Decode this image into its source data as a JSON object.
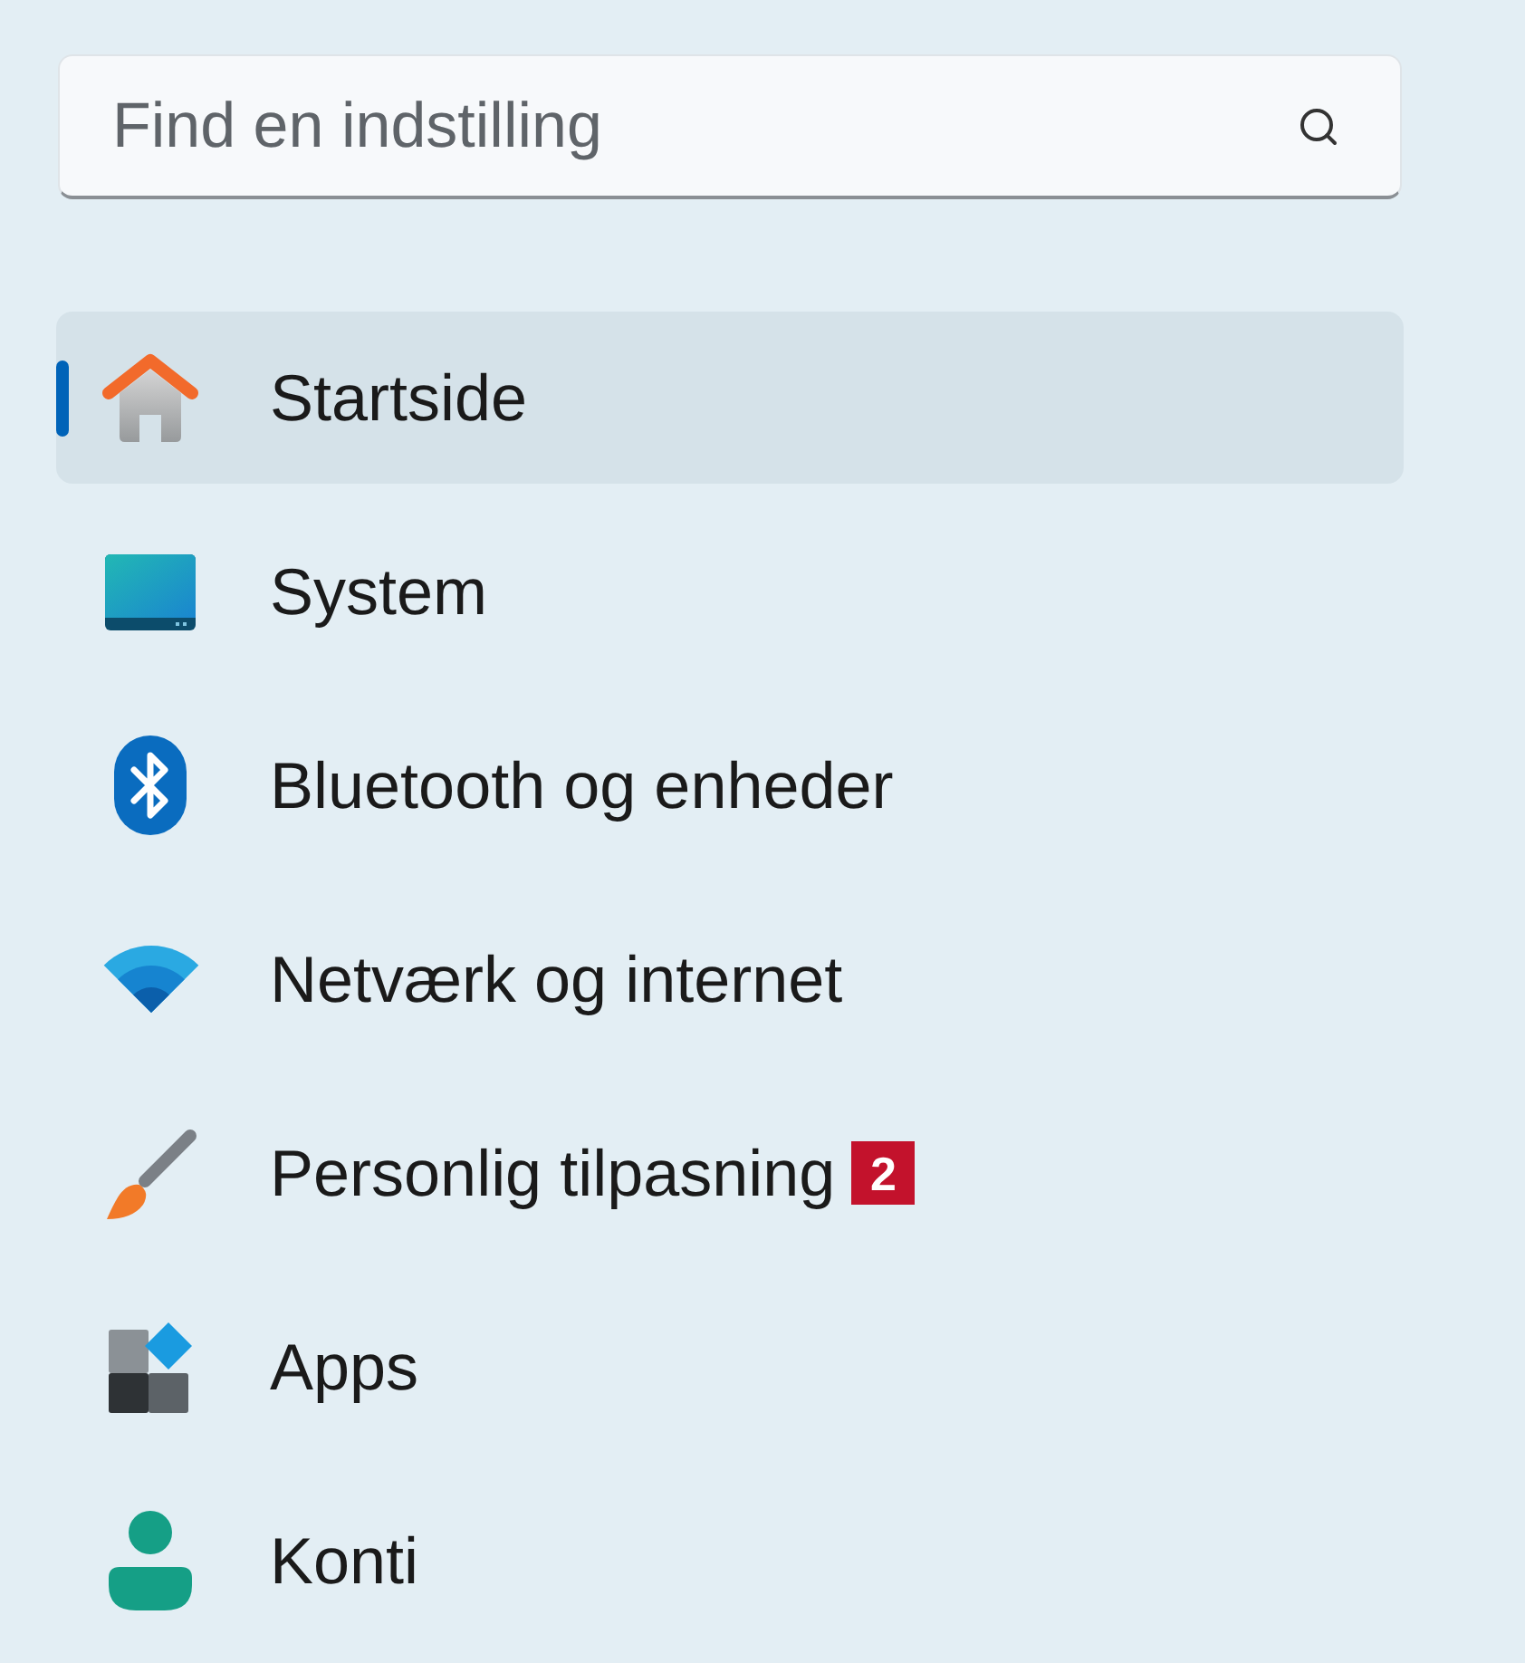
{
  "search": {
    "placeholder": "Find en indstilling"
  },
  "nav": {
    "items": [
      {
        "label": "Startside",
        "selected": true
      },
      {
        "label": "System",
        "selected": false
      },
      {
        "label": "Bluetooth og enheder",
        "selected": false
      },
      {
        "label": "Netværk og internet",
        "selected": false
      },
      {
        "label": "Personlig tilpasning",
        "selected": false,
        "badge": "2"
      },
      {
        "label": "Apps",
        "selected": false
      },
      {
        "label": "Konti",
        "selected": false
      }
    ]
  }
}
